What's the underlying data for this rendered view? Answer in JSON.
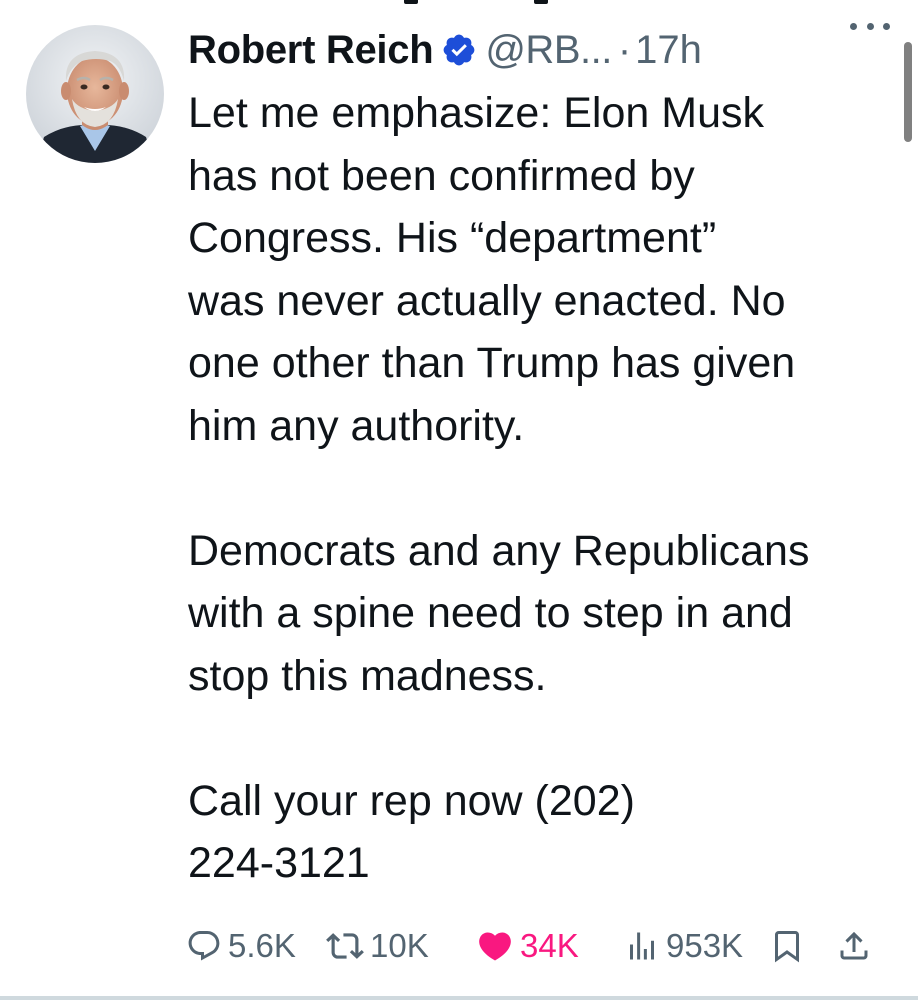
{
  "tweet": {
    "author": {
      "display_name": "Robert Reich",
      "handle": "@RB...",
      "verified": true
    },
    "separator": "·",
    "time": "17h",
    "paragraphs": [
      "Let me emphasize: Elon Musk\nhas not been confirmed by\nCongress. His “department”\nwas never actually enacted. No\none other than Trump has given\nhim any authority.",
      "Democrats and any Republicans\nwith a spine need to step in and\nstop this madness.",
      "Call your rep now (202)\n224-3121"
    ],
    "stats": {
      "replies": "5.6K",
      "retweets": "10K",
      "likes": "34K",
      "views": "953K"
    }
  },
  "colors": {
    "text": "#0f1419",
    "secondary": "#536471",
    "verified_badge": "#1d4ed8",
    "like": "#f91880"
  },
  "icons": {
    "verified": "verified-badge-icon",
    "more": "more-dots-icon",
    "reply": "reply-bubble-icon",
    "retweet": "retweet-icon",
    "like": "heart-filled-icon",
    "views": "views-bars-icon",
    "bookmark": "bookmark-icon",
    "share": "share-upload-icon"
  }
}
